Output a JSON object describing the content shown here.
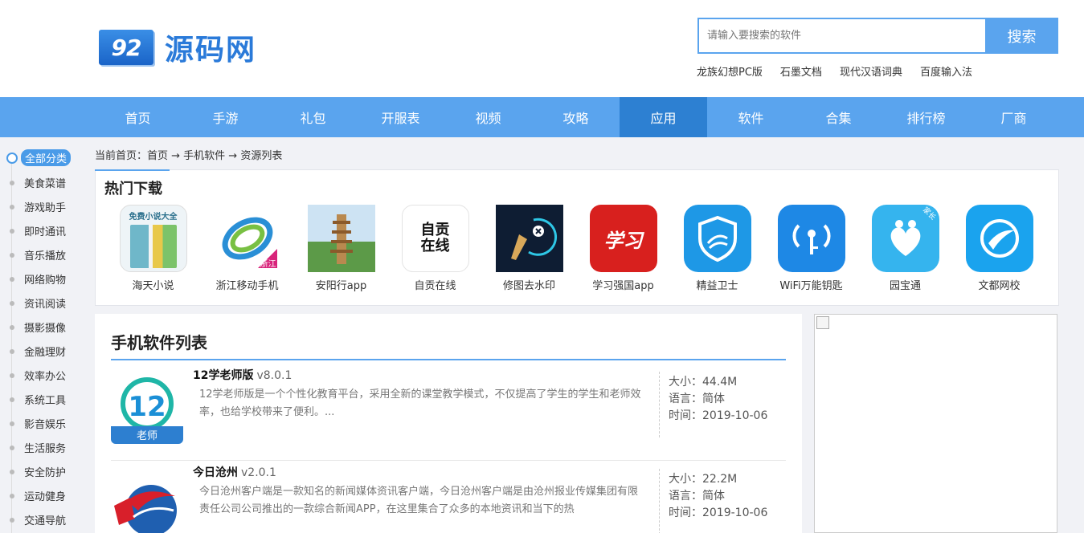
{
  "header": {
    "logo_mark": "92",
    "logo_text": "源码网",
    "search_placeholder": "请输入要搜索的软件",
    "search_button": "搜索",
    "hot_words": [
      "龙族幻想PC版",
      "石墨文档",
      "现代汉语词典",
      "百度输入法"
    ]
  },
  "nav": {
    "items": [
      "首页",
      "手游",
      "礼包",
      "开服表",
      "视频",
      "攻略",
      "应用",
      "软件",
      "合集",
      "排行榜",
      "厂商"
    ],
    "active": "应用"
  },
  "sidebar": {
    "all_label": "全部分类",
    "items": [
      "美食菜谱",
      "游戏助手",
      "即时通讯",
      "音乐播放",
      "网络购物",
      "资讯阅读",
      "摄影摄像",
      "金融理财",
      "效率办公",
      "系统工具",
      "影音娱乐",
      "生活服务",
      "安全防护",
      "运动健身",
      "交通导航"
    ]
  },
  "breadcrumb": "当前首页：首页 → 手机软件 → 资源列表",
  "hot": {
    "title": "热门下载",
    "apps": [
      {
        "name": "海天小说",
        "icon": "book-icon",
        "badge": "免费小说大全"
      },
      {
        "name": "浙江移动手机",
        "icon": "china-mobile-icon",
        "badge": "浙江"
      },
      {
        "name": "安阳行app",
        "icon": "pagoda-icon"
      },
      {
        "name": "自贡在线",
        "icon": "zigong-icon",
        "badge": "自贡在线"
      },
      {
        "name": "修图去水印",
        "icon": "brush-icon"
      },
      {
        "name": "学习强国app",
        "icon": "xuexi-icon",
        "badge": "学习"
      },
      {
        "name": "精益卫士",
        "icon": "shield-icon"
      },
      {
        "name": "WiFi万能钥匙",
        "icon": "wifi-key-icon"
      },
      {
        "name": "园宝通",
        "icon": "heart-people-icon",
        "badge": "家长"
      },
      {
        "name": "文都网校",
        "icon": "wendu-icon"
      }
    ]
  },
  "list": {
    "title": "手机软件列表",
    "items": [
      {
        "name": "12学老师版",
        "version": "v8.0.1",
        "desc": "12学老师版是一个个性化教育平台，采用全新的课堂教学模式，不仅提高了学生的学生和老师效率，也给学校带来了便利。...",
        "size": "大小：44.4M",
        "lang": "语言：简体",
        "time": "时间：2019-10-06",
        "icon_text": "12",
        "icon_sub": "老师"
      },
      {
        "name": "今日沧州",
        "version": "v2.0.1",
        "desc": "今日沧州客户端是一款知名的新闻媒体资讯客户端，今日沧州客户端是由沧州报业传媒集团有限责任公司公司推出的一款综合新闻APP，在这里集合了众多的本地资讯和当下的热",
        "size": "大小：22.2M",
        "lang": "语言：简体",
        "time": "时间：2019-10-06"
      }
    ]
  },
  "colors": {
    "accent": "#5aa4ee",
    "nav_active": "#2d80d2"
  }
}
